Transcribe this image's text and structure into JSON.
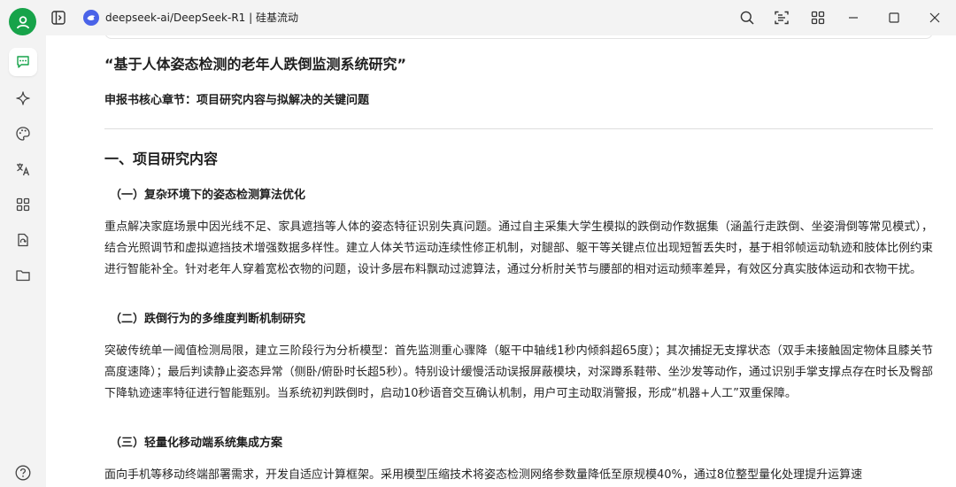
{
  "window": {
    "title": "deepseek-ai/DeepSeek-R1 | 硅基流动"
  },
  "titlebar": {
    "left_icons": [
      "user-avatar-icon",
      "sidebar-toggle-icon",
      "app-logo-icon"
    ],
    "right_icons": [
      "search-icon",
      "scan-icon",
      "grid-view-icon",
      "minimize-icon",
      "maximize-icon",
      "close-icon"
    ]
  },
  "rail": {
    "items": [
      "chat-icon",
      "sparkle-icon",
      "palette-icon",
      "translate-icon",
      "apps-icon",
      "document-sync-icon",
      "folder-icon"
    ],
    "bottom": "help-icon"
  },
  "colors": {
    "accent_green": "#17a34a",
    "logo_blue": "#4a63e8",
    "chrome_bg": "#f3f3f3"
  },
  "doc": {
    "title": "“基于人体姿态检测的老年人跌倒监测系统研究”",
    "subtitle": "申报书核心章节：项目研究内容与拟解决的关键问题",
    "section_1": "一、项目研究内容",
    "sub_1": "（一）复杂环境下的姿态检测算法优化",
    "para_1": "重点解决家庭场景中因光线不足、家具遮挡等人体的姿态特征识别失真问题。通过自主采集大学生模拟的跌倒动作数据集（涵盖行走跌倒、坐姿滑倒等常见模式），结合光照调节和虚拟遮挡技术增强数据多样性。建立人体关节运动连续性修正机制，对腿部、躯干等关键点位出现短暂丢失时，基于相邻帧运动轨迹和肢体比例约束进行智能补全。针对老年人穿着宽松衣物的问题，设计多层布料飘动过滤算法，通过分析肘关节与腰部的相对运动频率差异，有效区分真实肢体运动和衣物干扰。",
    "sub_2": "（二）跌倒行为的多维度判断机制研究",
    "para_2": "突破传统单一阈值检测局限，建立三阶段行为分析模型：首先监测重心骤降（躯干中轴线1秒内倾斜超65度）；其次捕捉无支撑状态（双手未接触固定物体且膝关节高度速降）；最后判读静止姿态异常（侧卧/俯卧时长超5秒）。特别设计缓慢活动误报屏蔽模块，对深蹲系鞋带、坐沙发等动作，通过识别手掌支撑点存在时长及臀部下降轨迹速率特征进行智能甄别。当系统初判跌倒时，启动10秒语音交互确认机制，用户可主动取消警报，形成“机器+人工”双重保障。",
    "sub_3": "（三）轻量化移动端系统集成方案",
    "para_3": "面向手机等移动终端部署需求，开发自适应计算框架。采用模型压缩技术将姿态检测网络参数量降低至原规模40%，通过8位整型量化处理提升运算速"
  }
}
